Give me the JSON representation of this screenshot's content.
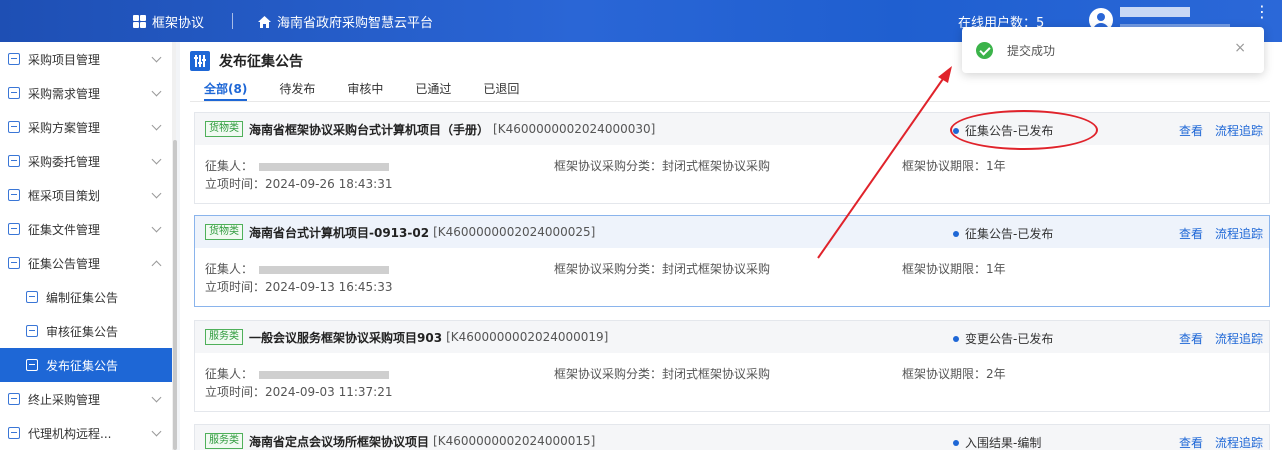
{
  "header": {
    "app_name": "框架协议",
    "platform_name": "海南省政府采购智慧云平台",
    "online_users": "在线用户数：5"
  },
  "sidebar": {
    "items": [
      {
        "label": "采购项目管理",
        "expanded": false
      },
      {
        "label": "采购需求管理",
        "expanded": false
      },
      {
        "label": "采购方案管理",
        "expanded": false
      },
      {
        "label": "采购委托管理",
        "expanded": false
      },
      {
        "label": "框采项目策划",
        "expanded": false
      },
      {
        "label": "征集文件管理",
        "expanded": false
      },
      {
        "label": "征集公告管理",
        "expanded": true
      },
      {
        "label": "编制征集公告"
      },
      {
        "label": "审核征集公告"
      },
      {
        "label": "发布征集公告",
        "active": true
      },
      {
        "label": "终止采购管理",
        "expanded": false
      },
      {
        "label": "代理机构远程...",
        "expanded": false
      }
    ]
  },
  "page": {
    "title": "发布征集公告",
    "tabs": [
      "全部(8)",
      "待发布",
      "审核中",
      "已通过",
      "已退回"
    ],
    "active_tab": 0
  },
  "labels": {
    "collector": "征集人：",
    "category": "框架协议采购分类：",
    "term": "框架协议期限：",
    "created": "立项时间：",
    "view": "查看",
    "trace": "流程追踪"
  },
  "projects": [
    {
      "type": "货物类",
      "title": "海南省框架协议采购台式计算机项目（手册）",
      "code": "[K4600000002024000030]",
      "status": "征集公告-已发布",
      "category": "封闭式框架协议采购",
      "term": "1年",
      "created": "2024-09-26 18:43:31"
    },
    {
      "type": "货物类",
      "title": "海南省台式计算机项目-0913-02",
      "code": "[K4600000002024000025]",
      "status": "征集公告-已发布",
      "category": "封闭式框架协议采购",
      "term": "1年",
      "created": "2024-09-13 16:45:33"
    },
    {
      "type": "服务类",
      "title": "一般会议服务框架协议采购项目903",
      "code": "[K4600000002024000019]",
      "status": "变更公告-已发布",
      "category": "封闭式框架协议采购",
      "term": "2年",
      "created": "2024-09-03 11:37:21"
    },
    {
      "type": "服务类",
      "title": "海南省定点会议场所框架协议项目",
      "code": "[K4600000002024000015]",
      "status": "入围结果-编制"
    }
  ],
  "toast": {
    "message": "提交成功",
    "close": "×"
  },
  "colors": {
    "primary": "#1e67d6",
    "success": "#3bb34a",
    "annotation": "#e0232b"
  }
}
